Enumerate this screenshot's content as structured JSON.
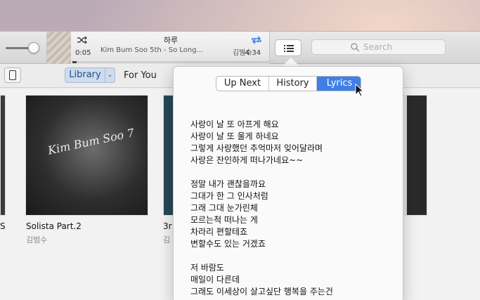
{
  "player": {
    "track_title": "하루",
    "track_subtitle": "Kim Bum Soo 5th - So Long...",
    "track_artist": "김범수",
    "elapsed": "0:05",
    "remaining": "-4:34",
    "progress": 0.02,
    "volume": 0.75
  },
  "search": {
    "placeholder": "Search"
  },
  "nav": {
    "library_label": "Library",
    "library_dropdown": "⌄",
    "for_you_label": "For You"
  },
  "albums": [
    {
      "title": "Solista Part.2",
      "artist": "김범수",
      "cover_text": "Kim Bum Soo 7"
    },
    {
      "title": "3r",
      "artist": "김"
    },
    {
      "title": "S",
      "artist": ""
    }
  ],
  "up_next_popover": {
    "tabs": [
      {
        "label": "Up Next",
        "selected": false
      },
      {
        "label": "History",
        "selected": false
      },
      {
        "label": "Lyrics",
        "selected": true
      }
    ],
    "lyrics": [
      "사랑이 날 또 아프게 해요",
      "사랑이 날 또 울게 하네요",
      "그렇게 사랑했던 추억마저 잊어달라며",
      "사랑은 잔인하게 떠나가네요~~",
      "",
      "정말 내가 괜찮을까요",
      "그대가 한 그 인사처럼",
      "그래 그대 눈가린체",
      "모르는척 떠나는 게",
      "차라리 편할테죠",
      "변할수도 있는 거겠죠",
      "",
      "저 바람도",
      "매일이 다른데",
      "그래도 이세상이 살고싶단 행복을 주는건"
    ]
  },
  "colors": {
    "accent": "#3f7fe6",
    "library_tab_bg": "#cfdcec",
    "library_tab_text": "#1a4d8f"
  },
  "icons": {
    "shuffle": "shuffle-icon",
    "repeat": "repeat-icon",
    "list": "list-icon",
    "search": "search-icon",
    "device": "iphone-icon"
  }
}
